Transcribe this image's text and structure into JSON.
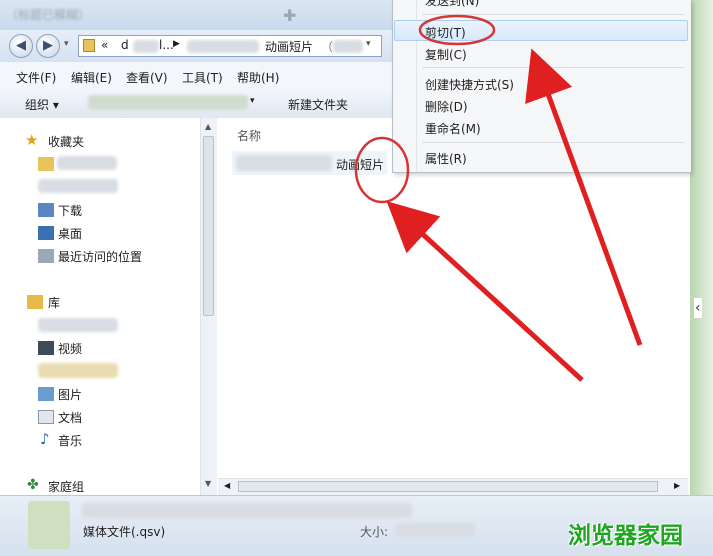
{
  "window": {
    "title": "（标题已模糊）",
    "address": {
      "prefix": "«",
      "seg1": "d",
      "seg2": "l...",
      "last": "动画短片"
    }
  },
  "menubar": [
    "文件(F)",
    "编辑(E)",
    "查看(V)",
    "工具(T)",
    "帮助(H)"
  ],
  "toolbar": {
    "organize": "组织 ▾",
    "newfolder": "新建文件夹"
  },
  "sidebar": {
    "favorites": "收藏夹",
    "download": "下载",
    "desktop": "桌面",
    "recent": "最近访问的位置",
    "library": "库",
    "video": "视频",
    "picture": "图片",
    "document": "文档",
    "music": "音乐",
    "homegroup": "家庭组"
  },
  "content": {
    "col_name": "名称",
    "file_name": "动画短片"
  },
  "contextmenu": {
    "sendto": "发送到(N)",
    "cut": "剪切(T)",
    "copy": "复制(C)",
    "shortcut": "创建快捷方式(S)",
    "delete": "删除(D)",
    "rename": "重命名(M)",
    "properties": "属性(R)"
  },
  "status": {
    "type": "媒体文件(.qsv)",
    "size_label": "大小:"
  },
  "watermark": "浏览器家园",
  "colors": {
    "annotation": "#e02020",
    "watermark": "#1fa51f"
  }
}
